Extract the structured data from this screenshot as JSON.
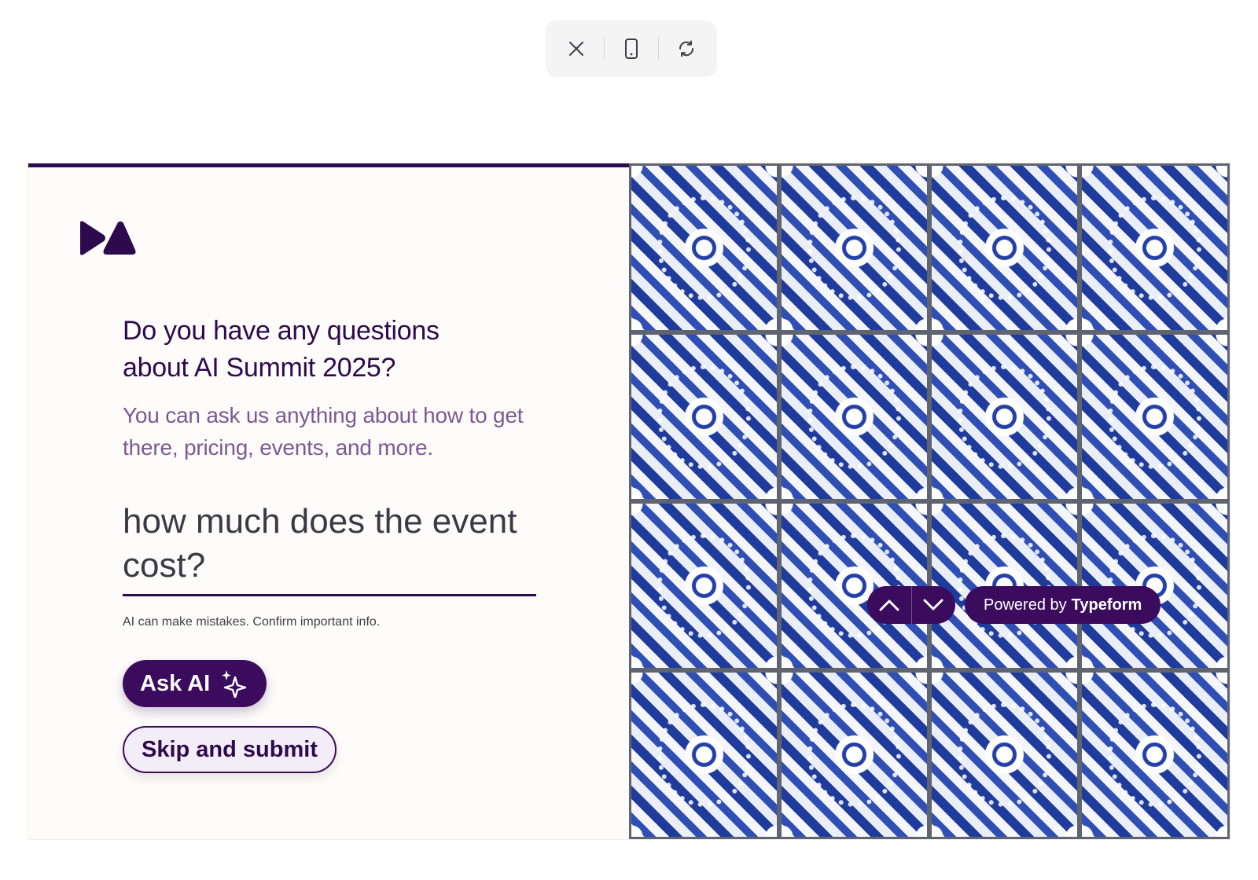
{
  "toolbar": {
    "buttons": [
      {
        "icon": "close-icon"
      },
      {
        "icon": "mobile-device-icon"
      },
      {
        "icon": "refresh-icon"
      }
    ]
  },
  "form": {
    "progress_fraction": 0.5,
    "logo_icon": "brand-logo-icon",
    "question": "Do you have any questions about AI Summit 2025?",
    "description": "You can ask us anything about how to get there, pricing, events, and more.",
    "answer_value": "how much does the event cost?",
    "disclaimer": "AI can make mistakes. Confirm important info.",
    "ask_ai_label": "Ask AI",
    "ask_ai_icon": "sparkles-icon",
    "skip_label": "Skip and submit"
  },
  "footer": {
    "prev_icon": "chevron-up-icon",
    "next_icon": "chevron-down-icon",
    "powered_prefix": "Powered by",
    "powered_brand": "Typeform"
  },
  "colors": {
    "brand": "#3b0b5e",
    "question_text": "#2d0a4e",
    "description_text": "#7a5a92",
    "background": "#fdfcfa"
  }
}
